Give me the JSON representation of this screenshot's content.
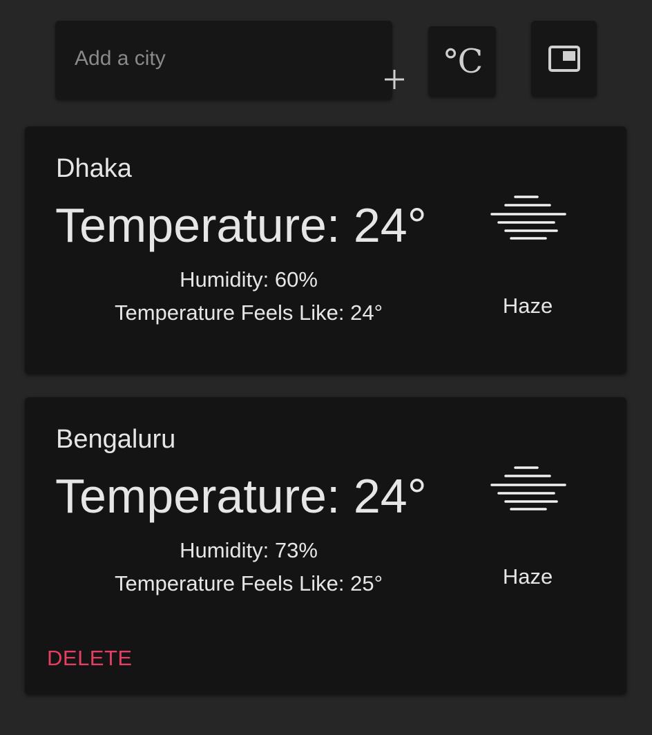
{
  "search": {
    "placeholder": "Add a city",
    "add_icon": "plus-icon"
  },
  "toolbar": {
    "unit_label": "°C",
    "view_icon": "picture-in-picture-icon"
  },
  "cities": [
    {
      "name": "Dhaka",
      "temperature": "Temperature: 24°",
      "humidity": "Humidity: 60%",
      "feels_like": "Temperature Feels Like: 24°",
      "condition": "Haze",
      "condition_icon": "haze-icon"
    },
    {
      "name": "Bengaluru",
      "temperature": "Temperature: 24°",
      "humidity": "Humidity: 73%",
      "feels_like": "Temperature Feels Like: 25°",
      "condition": "Haze",
      "condition_icon": "haze-icon",
      "delete_label": "DELETE"
    }
  ],
  "colors": {
    "background": "#262626",
    "card": "#141414",
    "text": "#e6e6e6",
    "placeholder": "#8a8a8a",
    "delete": "#e63d62"
  }
}
